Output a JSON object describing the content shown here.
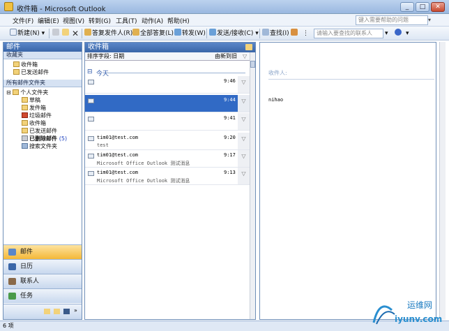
{
  "window": {
    "title": "收件箱 - Microsoft Outlook",
    "buttons": [
      "_",
      "□",
      "✕"
    ]
  },
  "menu": {
    "items": [
      "文件(F)",
      "编辑(E)",
      "视图(V)",
      "转到(G)",
      "工具(T)",
      "动作(A)",
      "帮助(H)"
    ],
    "help_placeholder": "键入需要帮助的问题"
  },
  "toolbar": {
    "new": "新建(N)",
    "reply_sender": "答复发件人(R)",
    "reply_all": "全部答复(L)",
    "forward": "转发(W)",
    "send_receive": "发送/接收(C)",
    "find": "查找(I)",
    "contact_placeholder": "请输入要查找的联系人"
  },
  "nav": {
    "title": "邮件",
    "favorites_header": "收藏夹",
    "favorites": [
      "收件箱",
      "已发送邮件"
    ],
    "all_folders_header": "所有邮件文件夹",
    "personal": "个人文件夹",
    "folders": [
      {
        "label": "草稿",
        "count": ""
      },
      {
        "label": "发件箱",
        "count": ""
      },
      {
        "label": "垃圾邮件",
        "count": ""
      },
      {
        "label": "收件箱",
        "count": ""
      },
      {
        "label": "已发送邮件",
        "count": ""
      },
      {
        "label": "已删除邮件",
        "count": "(5)"
      },
      {
        "label": "搜索文件夹",
        "count": ""
      }
    ],
    "buttons": [
      "邮件",
      "日历",
      "联系人",
      "任务"
    ]
  },
  "list": {
    "title": "收件箱",
    "sort_label": "排序字段: 日期",
    "sort_order": "由新到旧",
    "group": "今天",
    "rows": [
      {
        "from": "",
        "subject": "",
        "time": "9:46",
        "selected": false
      },
      {
        "from": "",
        "subject": "",
        "time": "9:44",
        "selected": true
      },
      {
        "from": "",
        "subject": "",
        "time": "9:41",
        "selected": false
      },
      {
        "from": "tim01@test.com",
        "subject": "test",
        "time": "9:20",
        "selected": false
      },
      {
        "from": "tim01@test.com",
        "subject": "Microsoft Office Outlook 测试消息",
        "time": "9:17",
        "selected": false
      },
      {
        "from": "tim01@test.com",
        "subject": "Microsoft Office Outlook 测试消息",
        "time": "9:13",
        "selected": false
      }
    ]
  },
  "reading": {
    "to_label": "收件人:",
    "body": "nihao"
  },
  "status": {
    "text": "6 项"
  },
  "watermark": {
    "text": "运维网",
    "url": "iyunv.com"
  },
  "colors": {
    "accent": "#3a66a8",
    "selection": "#316ac5"
  }
}
